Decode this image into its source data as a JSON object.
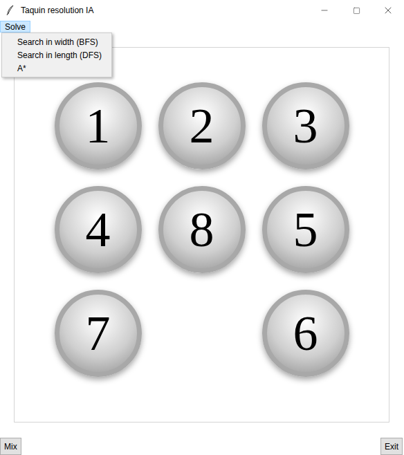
{
  "window": {
    "title": "Taquin resolution IA"
  },
  "menus": [
    {
      "label": "Solve",
      "open": true,
      "items": [
        "Search in width (BFS)",
        "Search in length (DFS)",
        "A*"
      ]
    }
  ],
  "board": {
    "tiles": [
      "1",
      "2",
      "3",
      "4",
      "8",
      "5",
      "7",
      "",
      "6"
    ]
  },
  "buttons": [
    "Mix",
    "Exit"
  ]
}
